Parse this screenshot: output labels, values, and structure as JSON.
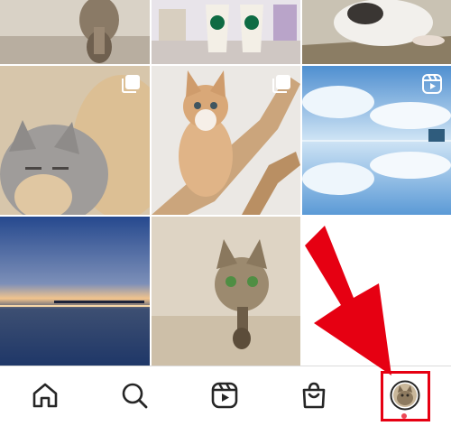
{
  "grid": {
    "posts": [
      {
        "subject": "cat-reflection-photo",
        "type": "photo"
      },
      {
        "subject": "starbucks-cups-photo",
        "type": "photo"
      },
      {
        "subject": "kitten-on-wood-photo",
        "type": "photo"
      },
      {
        "subject": "two-kittens-photo",
        "type": "carousel",
        "badge_icon": "multiple-photos-icon"
      },
      {
        "subject": "kitten-climbing-branch-photo",
        "type": "carousel",
        "badge_icon": "multiple-photos-icon"
      },
      {
        "subject": "salt-flat-sky-photo",
        "type": "reel",
        "badge_icon": "reels-icon"
      },
      {
        "subject": "sunset-lake-photo",
        "type": "photo"
      },
      {
        "subject": "cat-mirror-photo",
        "type": "photo"
      }
    ]
  },
  "bottom_nav": {
    "items": [
      {
        "name": "home",
        "icon": "home-icon"
      },
      {
        "name": "search",
        "icon": "search-icon"
      },
      {
        "name": "reels",
        "icon": "reels-icon"
      },
      {
        "name": "shop",
        "icon": "shop-bag-icon"
      },
      {
        "name": "profile",
        "icon": "profile-avatar-icon"
      }
    ],
    "notification_dot_color": "#ed4956"
  },
  "annotation": {
    "arrow_color": "#e60012",
    "highlight_color": "#e60012",
    "target": "profile"
  }
}
